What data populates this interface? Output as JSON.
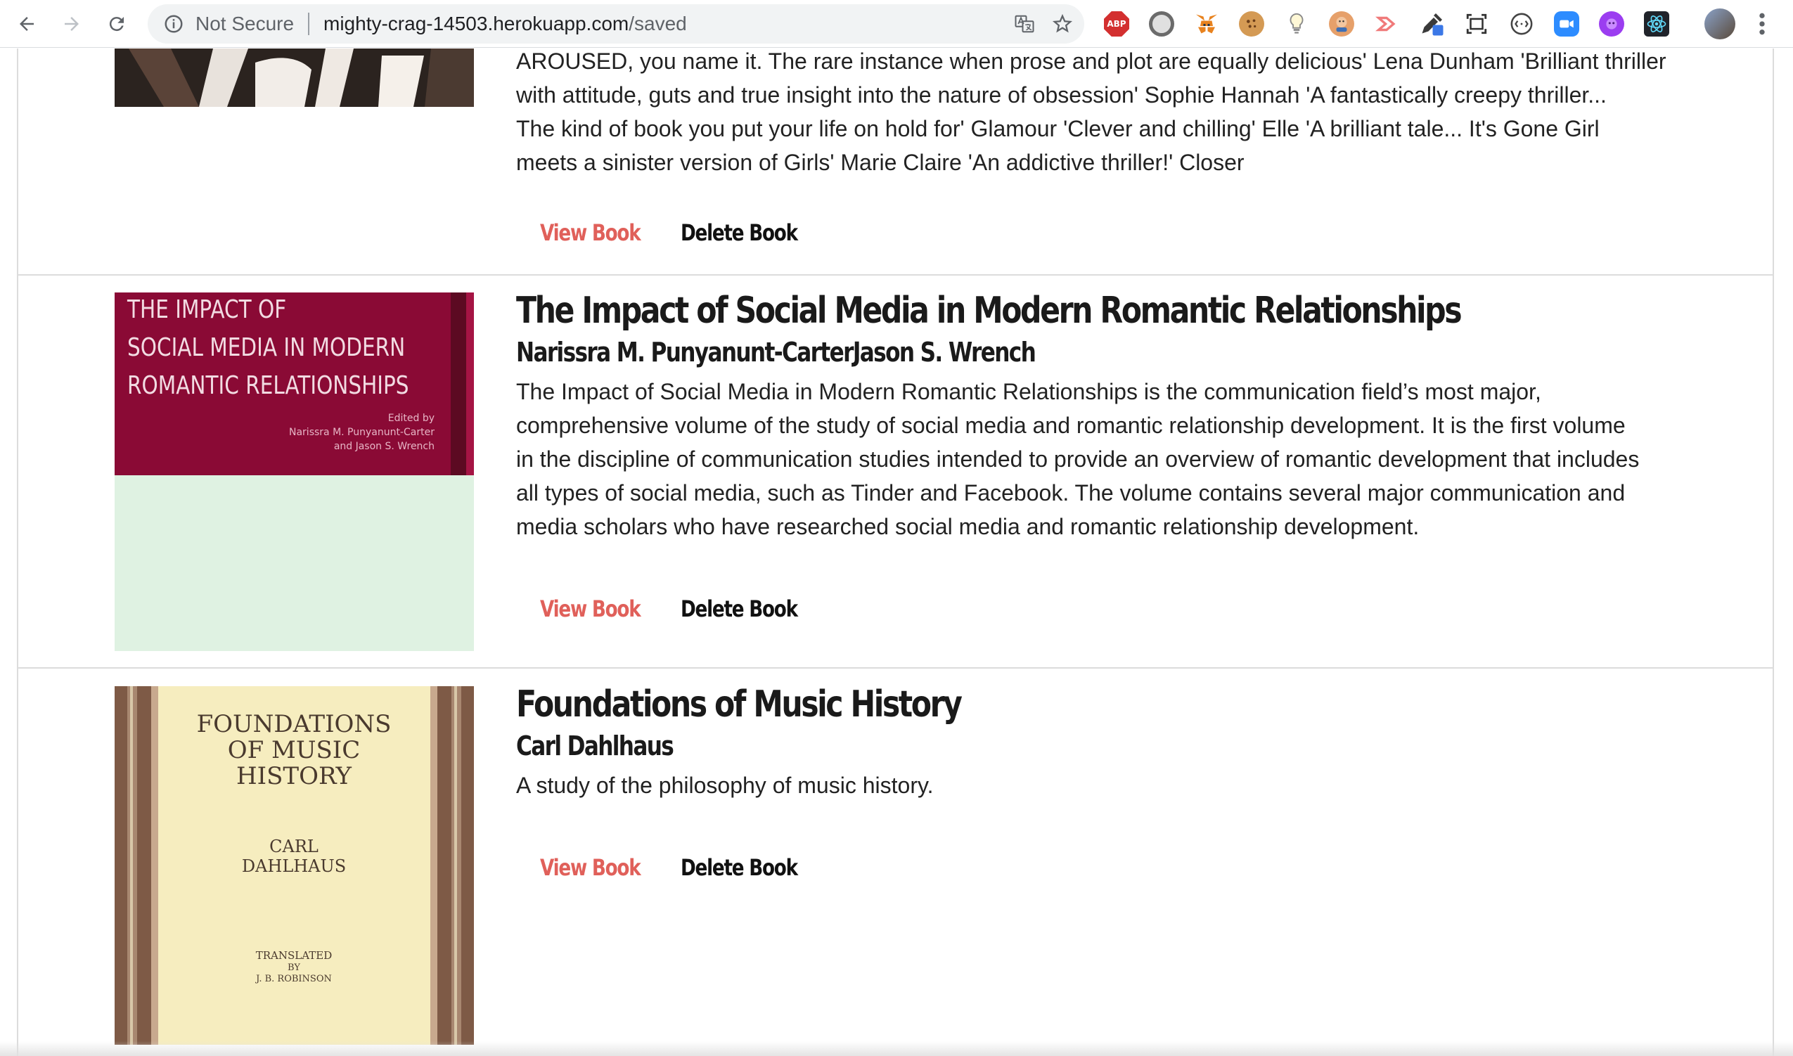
{
  "browser": {
    "security_label": "Not Secure",
    "url_host": "mighty-crag-14503.herokuapp.com",
    "url_path": "/saved",
    "icons": [
      "back-icon",
      "forward-icon",
      "reload-icon",
      "info-icon",
      "translate-icon",
      "bookmark-star-icon",
      "adblock-icon",
      "extension-icon",
      "metamask-icon",
      "cookie-icon",
      "lightbulb-icon",
      "extension-icon",
      "extension-icon",
      "eyedropper-icon",
      "screenshot-icon",
      "extension-icon",
      "zoom-icon",
      "extension-icon",
      "react-devtools-icon",
      "profile-avatar",
      "menu-icon"
    ],
    "adblock_label": "ABP"
  },
  "books": [
    {
      "title": "",
      "author": "",
      "description_lines": [
        "AROUSED, you name it. The rare instance when prose and plot are equally delicious' Lena Dunham 'Brilliant thriller",
        "with attitude, guts and true insight into the nature of obsession' Sophie Hannah 'A fantastically creepy thriller...",
        "The kind of book you put your life on hold for' Glamour 'Clever and chilling' Elle 'A brilliant tale... It's Gone Girl",
        "meets a sinister version of Girls' Marie Claire 'An addictive thriller!' Closer"
      ],
      "view_label": "View Book",
      "delete_label": "Delete Book"
    },
    {
      "title": "The Impact of Social Media in Modern Romantic Relationships",
      "author": "Narissra M. Punyanunt-CarterJason S. Wrench",
      "description_lines": [
        "The Impact of Social Media in Modern Romantic Relationships is the communication field’s most major,",
        "comprehensive volume of the study of social media and romantic relationship development. It is the first volume",
        "in the discipline of communication studies intended to provide an overview of romantic development that includes",
        "all types of social media, such as Tinder and Facebook. The volume contains several major communication and",
        "media scholars who have researched social media and romantic relationship development."
      ],
      "cover_lines": [
        "THE IMPACT OF",
        "SOCIAL MEDIA IN MODERN",
        "ROMANTIC RELATIONSHIPS"
      ],
      "cover_small": [
        "Edited by",
        "Narissra M. Punyanunt-Carter",
        "and Jason S. Wrench"
      ],
      "cover_colors": {
        "top": "#8a0a35",
        "bottom": "#dff2e2",
        "stripe": "#5c0a22"
      },
      "view_label": "View Book",
      "delete_label": "Delete Book"
    },
    {
      "title": "Foundations of Music History",
      "author": "Carl Dahlhaus",
      "description_lines": [
        "A study of the philosophy of music history."
      ],
      "cover_lines": [
        "FOUNDATIONS",
        "OF MUSIC",
        "HISTORY"
      ],
      "cover_author": [
        "CARL",
        "DAHLHAUS"
      ],
      "cover_small": [
        "TRANSLATED",
        "BY",
        "J. B. ROBINSON"
      ],
      "cover_colors": {
        "border": "#7e5a46",
        "panel": "#f6edbf",
        "text": "#4a3a2e"
      },
      "view_label": "View Book",
      "delete_label": "Delete Book"
    }
  ],
  "colors": {
    "view_button": "#e0605a",
    "delete_button": "#111111",
    "title": "#1a1a1a"
  }
}
